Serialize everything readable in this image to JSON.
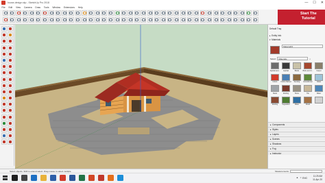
{
  "window": {
    "title": "house-design.skp - SketchUp Pro 2018",
    "controls": [
      "—",
      "☐",
      "✕"
    ]
  },
  "menu": [
    "File",
    "Edit",
    "View",
    "Camera",
    "Draw",
    "Tools",
    "Window",
    "Extensions",
    "Help"
  ],
  "brand": {
    "line1": "Start The",
    "line2": "Tutorial"
  },
  "tray": {
    "title": "Default Tray",
    "entity_info": "Entity Info",
    "materials": "Materials",
    "material_name": "Material23",
    "select_label": "Select",
    "category": "Materials",
    "thumbnails": [
      {
        "label": "Asphalt and...",
        "color": "#6d6d6d"
      },
      {
        "label": "Asphalt",
        "color": "#3a3a3a"
      },
      {
        "label": "Blinds",
        "color": "#c9c2a8"
      },
      {
        "label": "Brick and Cl...",
        "color": "#a5472f"
      },
      {
        "label": "Carpet",
        "color": "#8a7f6b"
      },
      {
        "label": "Colors",
        "color": "#d23b2b"
      },
      {
        "label": "Colors-Named",
        "color": "#4a7fb5"
      },
      {
        "label": "Fencing",
        "color": "#8c6a3f"
      },
      {
        "label": "Groundcover",
        "color": "#5f8a3a"
      },
      {
        "label": "Glass",
        "color": "#9ec4d8"
      },
      {
        "label": "Metal",
        "color": "#a0a4a8"
      },
      {
        "label": "Roofing",
        "color": "#7a3a2c"
      },
      {
        "label": "Stone",
        "color": "#9a9385"
      },
      {
        "label": "Tile",
        "color": "#c8b89a"
      },
      {
        "label": "Water",
        "color": "#4d86b8"
      },
      {
        "label": "Roofing",
        "color": "#8a4a32"
      },
      {
        "label": "Vegetation",
        "color": "#4e7b31"
      },
      {
        "label": "Water",
        "color": "#2f6fa3"
      },
      {
        "label": "Wood",
        "color": "#a47244"
      },
      {
        "label": "",
        "color": "#d2d2d2"
      }
    ],
    "panels": [
      "Components",
      "Styles",
      "Layers",
      "Scenes",
      "Shadows",
      "Fog",
      "Instructor"
    ]
  },
  "status": {
    "text": "Select objects. Shift to extend select. Drag mouse to select multiple.",
    "measurements_label": "Measurements",
    "measurements_value": ""
  },
  "taskbar": {
    "apps": [
      {
        "name": "search-app",
        "color": "#1f1f1f"
      },
      {
        "name": "task-view",
        "color": "#444444"
      },
      {
        "name": "edge",
        "color": "#1e6fc2"
      },
      {
        "name": "file-explorer",
        "color": "#e8b23a"
      },
      {
        "name": "store",
        "color": "#2e5fa8"
      },
      {
        "name": "chrome",
        "color": "#d23b2b"
      },
      {
        "name": "word",
        "color": "#2b579a"
      },
      {
        "name": "excel",
        "color": "#217346"
      },
      {
        "name": "powerpoint",
        "color": "#d24726"
      },
      {
        "name": "sketchup",
        "color": "#c0392b"
      },
      {
        "name": "media-player",
        "color": "#e46f1b"
      },
      {
        "name": "photos",
        "color": "#1d8fd8"
      }
    ],
    "language": "ENG",
    "time": "11:25 AM",
    "date": "11-Apr-20"
  },
  "colors": {
    "sky": "#c6dcc5",
    "ground": "#c8b485",
    "paving": "#8d8d8d",
    "wall": "#6b4a26",
    "roof": "#b02e22",
    "house_wall": "#e7a552"
  }
}
